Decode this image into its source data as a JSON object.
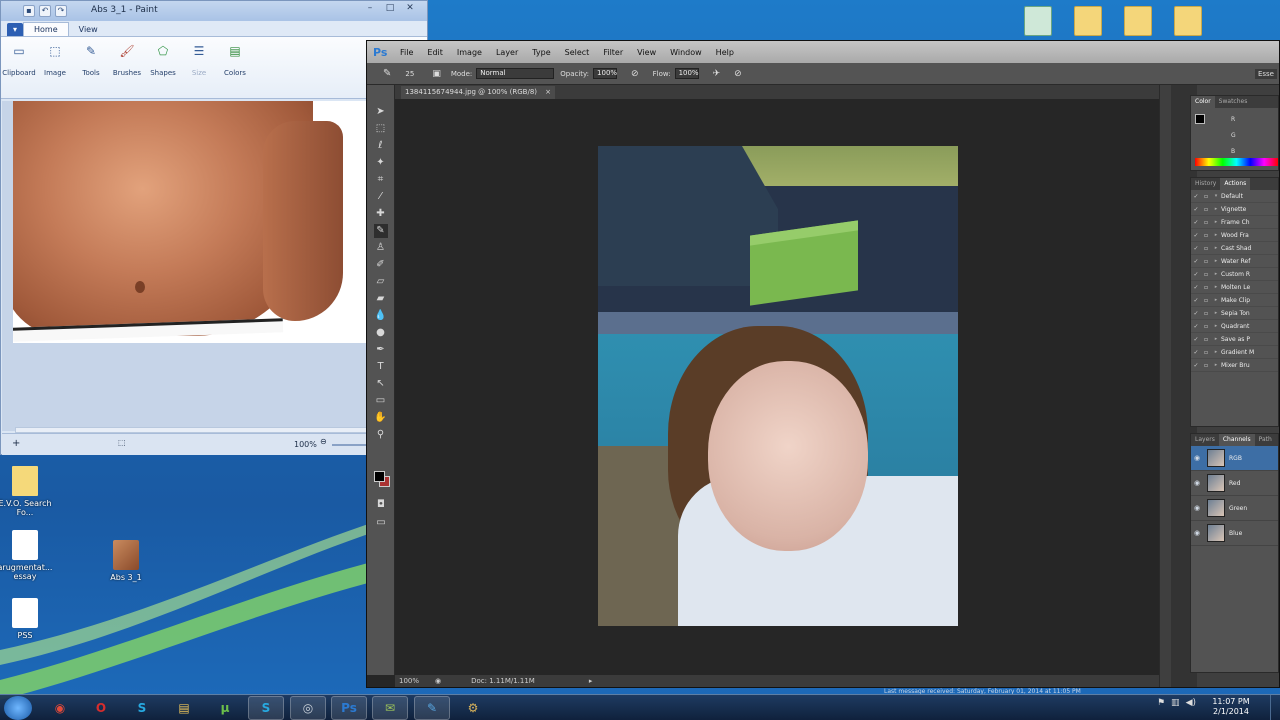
{
  "paint": {
    "title": "Abs 3_1 - Paint",
    "file_tab": "▾",
    "tabs": [
      "Home",
      "View"
    ],
    "ribbon_groups": [
      "Clipboard",
      "Image",
      "Tools",
      "Brushes",
      "Shapes",
      "Size",
      "Colors"
    ],
    "zoom": "100%",
    "controls": {
      "minimize": "–",
      "maximize": "□",
      "close": "✕"
    }
  },
  "photoshop": {
    "logo": "Ps",
    "menus": [
      "File",
      "Edit",
      "Image",
      "Layer",
      "Type",
      "Select",
      "Filter",
      "View",
      "Window",
      "Help"
    ],
    "options": {
      "brush_size": "25",
      "mode_label": "Mode:",
      "mode_value": "Normal",
      "opacity_label": "Opacity:",
      "opacity_value": "100%",
      "flow_label": "Flow:",
      "flow_value": "100%",
      "essentials": "Esse"
    },
    "document_tab": "1384115674944.jpg @ 100% (RGB/8)",
    "status": {
      "zoom": "100%",
      "doc": "Doc: 1.11M/1.11M"
    },
    "color_panel": {
      "tabs": [
        "Color",
        "Swatches"
      ],
      "channels": [
        "R",
        "G",
        "B"
      ]
    },
    "actions_panel": {
      "tabs": [
        "History",
        "Actions"
      ],
      "items": [
        "Default",
        "Vignette",
        "Frame Ch",
        "Wood Fra",
        "Cast Shad",
        "Water Ref",
        "Custom R",
        "Molten Le",
        "Make Clip",
        "Sepia Ton",
        "Quadrant",
        "Save as P",
        "Gradient M",
        "Mixer Bru"
      ]
    },
    "layers_panel": {
      "tabs": [
        "Layers",
        "Channels",
        "Path"
      ],
      "channels": [
        "RGB",
        "Red",
        "Green",
        "Blue"
      ]
    }
  },
  "desktop": {
    "icons": [
      {
        "label": "E.V.O. Search Fo...",
        "icon": "folder"
      },
      {
        "label": "arugmentat... essay",
        "icon": "document"
      },
      {
        "label": "Abs 3_1",
        "icon": "image"
      },
      {
        "label": "PSS",
        "icon": "document"
      }
    ],
    "top_icons": [
      "folder",
      "folder",
      "folder",
      "folder"
    ]
  },
  "taskbar": {
    "apps": [
      {
        "name": "chrome",
        "glyph": "◉",
        "color": "#e24a3a"
      },
      {
        "name": "opera",
        "glyph": "O",
        "color": "#d62d2d"
      },
      {
        "name": "skype-1",
        "glyph": "S",
        "color": "#27a9e0"
      },
      {
        "name": "explorer",
        "glyph": "▤",
        "color": "#e8c25a"
      },
      {
        "name": "utorrent",
        "glyph": "μ",
        "color": "#6cc04a"
      },
      {
        "name": "skype-2",
        "glyph": "S",
        "color": "#27a9e0"
      },
      {
        "name": "steam",
        "glyph": "◎",
        "color": "#c9d1da"
      },
      {
        "name": "photoshop",
        "glyph": "Ps",
        "color": "#2b7ad2"
      },
      {
        "name": "tool",
        "glyph": "✉",
        "color": "#9bc35a"
      },
      {
        "name": "paint",
        "glyph": "✎",
        "color": "#58a6e0"
      },
      {
        "name": "misc",
        "glyph": "⚙",
        "color": "#d9b35a"
      }
    ],
    "notification": "Last message received: Saturday, February 01, 2014 at 11:05 PM",
    "time": "11:07 PM",
    "date": "2/1/2014"
  }
}
